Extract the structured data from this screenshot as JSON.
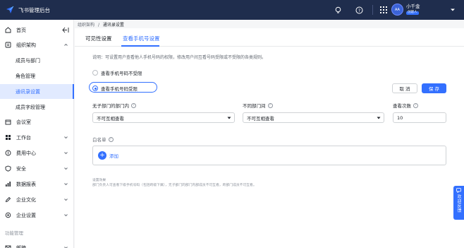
{
  "app": {
    "title": "飞书管理后台"
  },
  "user": {
    "avatar": "AA",
    "name": "小千金",
    "tag": "创建人"
  },
  "nav": {
    "home": "首页",
    "org": "组织架构",
    "sub": [
      "成员与部门",
      "角色管理",
      "通讯录设置",
      "成员字段管理"
    ],
    "meeting": "会议室",
    "workplace": "工作台",
    "expense": "费用中心",
    "security": "安全",
    "reports": "数据报表",
    "culture": "企业文化",
    "settings": "企业设置",
    "group_label": "功能管理",
    "mail": "邮箱"
  },
  "breadcrumb": {
    "parent": "组织架构",
    "sep": "/",
    "current": "通讯录设置"
  },
  "tabs": [
    "可见性设置",
    "查看手机号设置"
  ],
  "description": "说明：可设置用户查看他人手机号码的权限，修改用户间互看号码受限或不受限的各类规则。",
  "radios": [
    "查看手机号码不受限",
    "查看手机号码受限"
  ],
  "buttons": {
    "cancel": "取 消",
    "save": "保 存"
  },
  "fields": {
    "same_dept": {
      "label": "无子部门的部门内",
      "value": "不可互相查看"
    },
    "diff_dept": {
      "label": "不同部门间",
      "value": "不可互相查看"
    },
    "view_count": {
      "label": "查看次数",
      "value": "10"
    }
  },
  "whitelist": {
    "label": "白名单",
    "add": "添加"
  },
  "note": {
    "title": "设置效果",
    "body": "部门负责人可查看下级手机号码（包括跨级下属），无子部门的部门内部成员不可互看，跨部门成员不可互看。"
  },
  "feedback": "欢迎反馈",
  "colors": {
    "accent": "#3370ff",
    "topbar": "#1f2d4d"
  }
}
